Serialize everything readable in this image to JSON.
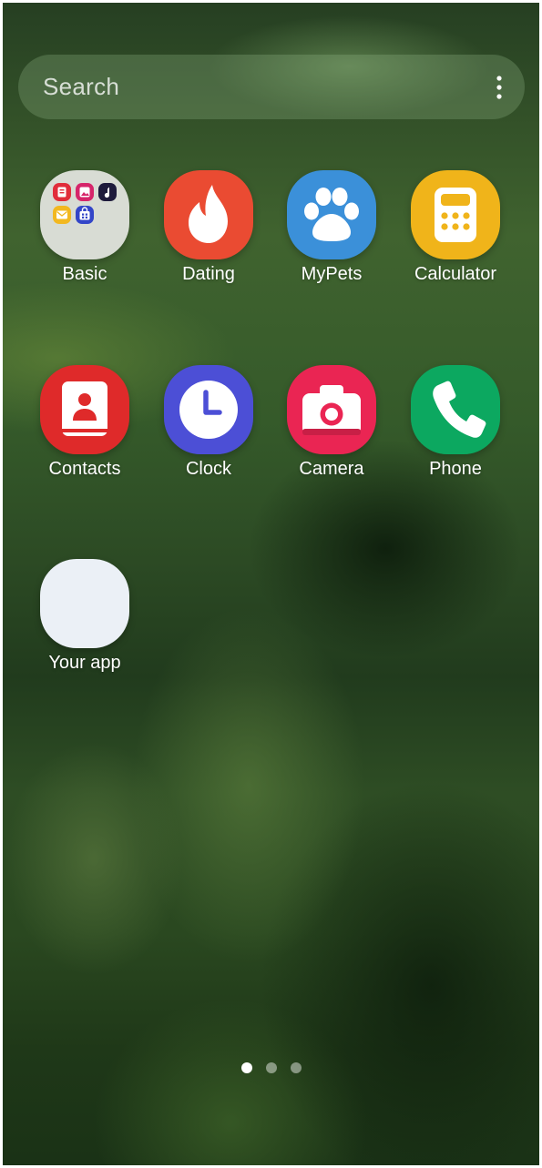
{
  "search": {
    "placeholder": "Search",
    "menu_icon": "more-vertical-icon"
  },
  "apps": [
    {
      "label": "Basic",
      "icon": "folder-icon",
      "color": "#d8dcd4"
    },
    {
      "label": "Dating",
      "icon": "flame-icon",
      "color": "#ea4b32"
    },
    {
      "label": "MyPets",
      "icon": "paw-icon",
      "color": "#3b90d9"
    },
    {
      "label": "Calculator",
      "icon": "calculator-icon",
      "color": "#f0b41a"
    },
    {
      "label": "Contacts",
      "icon": "contacts-book-icon",
      "color": "#df2a2a"
    },
    {
      "label": "Clock",
      "icon": "clock-icon",
      "color": "#4c4fd6"
    },
    {
      "label": "Camera",
      "icon": "camera-icon",
      "color": "#ea2553"
    },
    {
      "label": "Phone",
      "icon": "phone-icon",
      "color": "#0ca860"
    },
    {
      "label": "Your app",
      "icon": "blank-app-icon",
      "color": "#ebf0f6"
    }
  ],
  "folder_minis": [
    {
      "icon": "notes-mini-icon",
      "color": "#e12c3a"
    },
    {
      "icon": "gallery-mini-icon",
      "color": "#d6256a"
    },
    {
      "icon": "music-mini-icon",
      "color": "#1e1b3c"
    },
    {
      "icon": "email-mini-icon",
      "color": "#f2b820"
    },
    {
      "icon": "store-mini-icon",
      "color": "#3346c8"
    }
  ],
  "page_indicator": {
    "count": 3,
    "active": 0,
    "active_color": "#ffffff",
    "inactive_color": "rgba(255,255,255,0.45)"
  }
}
